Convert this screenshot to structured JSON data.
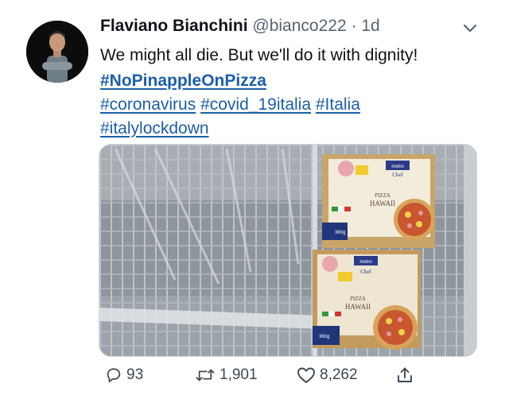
{
  "tweet": {
    "author_name": "Flaviano Bianchini",
    "handle": "@bianco222",
    "separator": "·",
    "age": "1d",
    "text": "We might all die. But we'll do it with dignity!",
    "hashtags": [
      "#NoPinappleOnPizza",
      "#coronavirus",
      "#covid_19italia",
      "#Italia",
      "#italylockdown"
    ]
  },
  "photo": {
    "pizza_box_labels": {
      "brand": "metro",
      "sub_brand": "Chef",
      "product": "PIZZA",
      "variety": "HAWAII",
      "weight": "360g"
    }
  },
  "actions": {
    "replies": "93",
    "retweets": "1,901",
    "likes": "8,262"
  },
  "icons": [
    "chevron-down-icon",
    "reply-icon",
    "retweet-icon",
    "like-icon",
    "share-icon"
  ],
  "colors": {
    "link": "#1d5fa8",
    "secondary_text": "#556572",
    "action_gray": "#3c4852"
  }
}
